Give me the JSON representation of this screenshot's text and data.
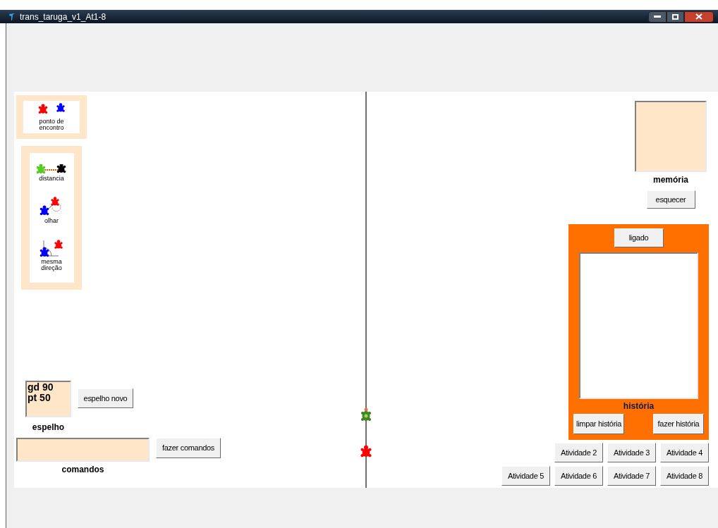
{
  "window": {
    "title": "trans_taruga_v1_At1-8"
  },
  "palettes": [
    {
      "tools": [
        {
          "kind": "meeting",
          "label": "ponto de encontro"
        }
      ]
    },
    {
      "tools": [
        {
          "kind": "distance",
          "label": "distancia"
        },
        {
          "kind": "look",
          "label": "olhar"
        },
        {
          "kind": "direction",
          "label": "mesma direção"
        }
      ]
    }
  ],
  "mirror": {
    "value": "gd 90\npt 50",
    "label": "espelho",
    "button": "espelho novo"
  },
  "commands": {
    "label": "comandos",
    "button": "fazer comandos"
  },
  "memory": {
    "label": "memória",
    "button": "esquecer"
  },
  "history": {
    "toggle": "ligado",
    "label": "história",
    "buttons": [
      "limpar história",
      "fazer história"
    ]
  },
  "activities": [
    [
      "Atividade 2",
      "Atividade 3",
      "Atividade 4"
    ],
    [
      "Atividade 5",
      "Atividade 6",
      "Atividade 7",
      "Atividade 8"
    ]
  ]
}
